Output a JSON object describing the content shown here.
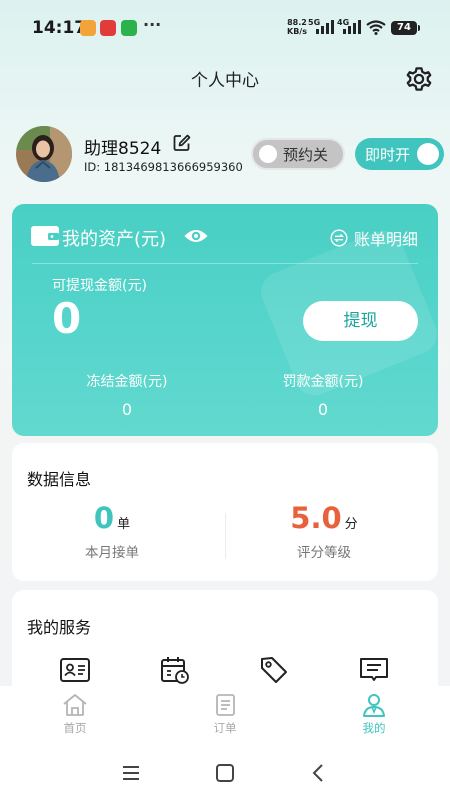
{
  "status_bar": {
    "time": "14:17",
    "net_speed_value": "88.2",
    "net_speed_unit": "KB/s",
    "signal_1": "5G",
    "signal_2": "4G",
    "battery": "74",
    "more": "···"
  },
  "header": {
    "title": "个人中心",
    "settings_icon": "gear-icon"
  },
  "profile": {
    "username": "助理8524",
    "id_text": "ID: 1813469813666959360",
    "booking_toggle": {
      "label": "预约关",
      "on": false
    },
    "instant_toggle": {
      "label": "即时开",
      "on": true
    }
  },
  "assets": {
    "title": "我的资产(元)",
    "bill_link": "账单明细",
    "available_label": "可提现金额(元)",
    "available_value": "0",
    "withdraw_button": "提现",
    "frozen_label": "冻结金额(元)",
    "frozen_value": "0",
    "fine_label": "罚款金额(元)",
    "fine_value": "0",
    "accent_color": "#4fd2c8"
  },
  "data_info": {
    "title": "数据信息",
    "orders_value": "0",
    "orders_unit": "单",
    "orders_label": "本月接单",
    "orders_color": "#3fc5bd",
    "rating_value": "5.0",
    "rating_unit": "分",
    "rating_label": "评分等级",
    "rating_color": "#e8603c"
  },
  "services": {
    "title": "我的服务",
    "icons": [
      "id-card-icon",
      "calendar-clock-icon",
      "tag-icon",
      "message-icon"
    ]
  },
  "tabbar": {
    "home": "首页",
    "orders": "订单",
    "mine": "我的",
    "active": "mine",
    "active_color": "#3fc5bd"
  },
  "navbar": {
    "icons": [
      "menu-icon",
      "home-square-icon",
      "back-icon"
    ]
  }
}
